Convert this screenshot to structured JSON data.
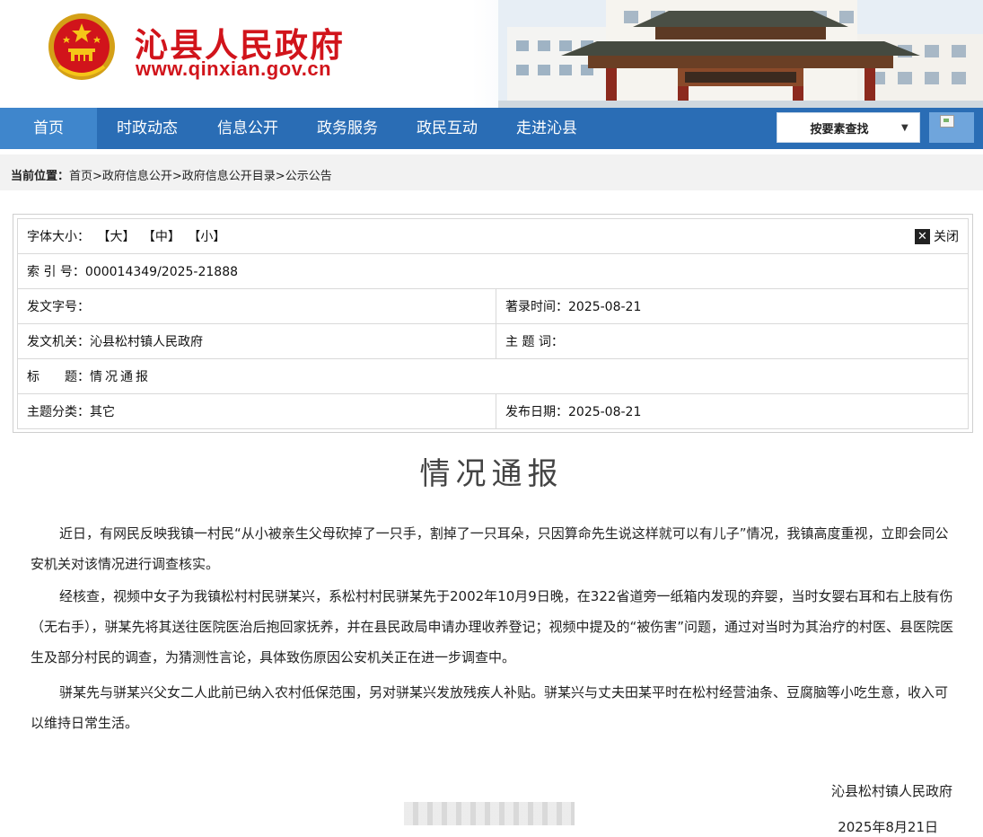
{
  "header": {
    "site_title": "沁县人民政府",
    "site_url": "www.qinxian.gov.cn",
    "emblem_icon": "national-emblem-icon",
    "banner_image": "city-gate-building"
  },
  "nav": {
    "items": [
      {
        "label": "首页",
        "active": true
      },
      {
        "label": "时政动态"
      },
      {
        "label": "信息公开"
      },
      {
        "label": "政务服务"
      },
      {
        "label": "政民互动"
      },
      {
        "label": "走进沁县"
      }
    ],
    "search_select": "按要素查找",
    "accent_color": "#2a6db5"
  },
  "breadcrumb": {
    "label": "当前位置：",
    "path": "首页>政府信息公开>政府信息公开目录>公示公告"
  },
  "info": {
    "font_size_label": "字体大小：",
    "font_size_large": "【大】",
    "font_size_medium": "【中】",
    "font_size_small": "【小】",
    "close_label": "关闭",
    "index_label": "索 引 号：",
    "index_value": "000014349/2025-21888",
    "doc_no_label": "发文字号：",
    "doc_no_value": "",
    "record_time_label": "著录时间：",
    "record_time_value": "2025-08-21",
    "issuer_label": "发文机关：",
    "issuer_value": "沁县松村镇人民政府",
    "keyword_label": "主 题 词：",
    "keyword_value": "",
    "title_label": "标　　题：",
    "title_value": "情况通报",
    "category_label": "主题分类：",
    "category_value": "其它",
    "publish_date_label": "发布日期：",
    "publish_date_value": "2025-08-21"
  },
  "article": {
    "title": "情况通报",
    "paragraphs": [
      "近日，有网民反映我镇一村民“从小被亲生父母砍掉了一只手，割掉了一只耳朵，只因算命先生说这样就可以有儿子”情况，我镇高度重视，立即会同公安机关对该情况进行调查核实。",
      "经核查，视频中女子为我镇松村村民骈某兴，系松村村民骈某先于2002年10月9日晚，在322省道旁一纸箱内发现的弃婴，当时女婴右耳和右上肢有伤（无右手），骈某先将其送往医院医治后抱回家抚养，并在县民政局申请办理收养登记；视频中提及的“被伤害”问题，通过对当时为其治疗的村医、县医院医生及部分村民的调查，为猜测性言论，具体致伤原因公安机关正在进一步调查中。",
      "骈某先与骈某兴父女二人此前已纳入农村低保范围，另对骈某兴发放残疾人补贴。骈某兴与丈夫田某平时在松村经营油条、豆腐脑等小吃生意，收入可以维持日常生活。"
    ],
    "signature_org": "沁县松村镇人民政府",
    "signature_date": "2025年8月21日"
  }
}
